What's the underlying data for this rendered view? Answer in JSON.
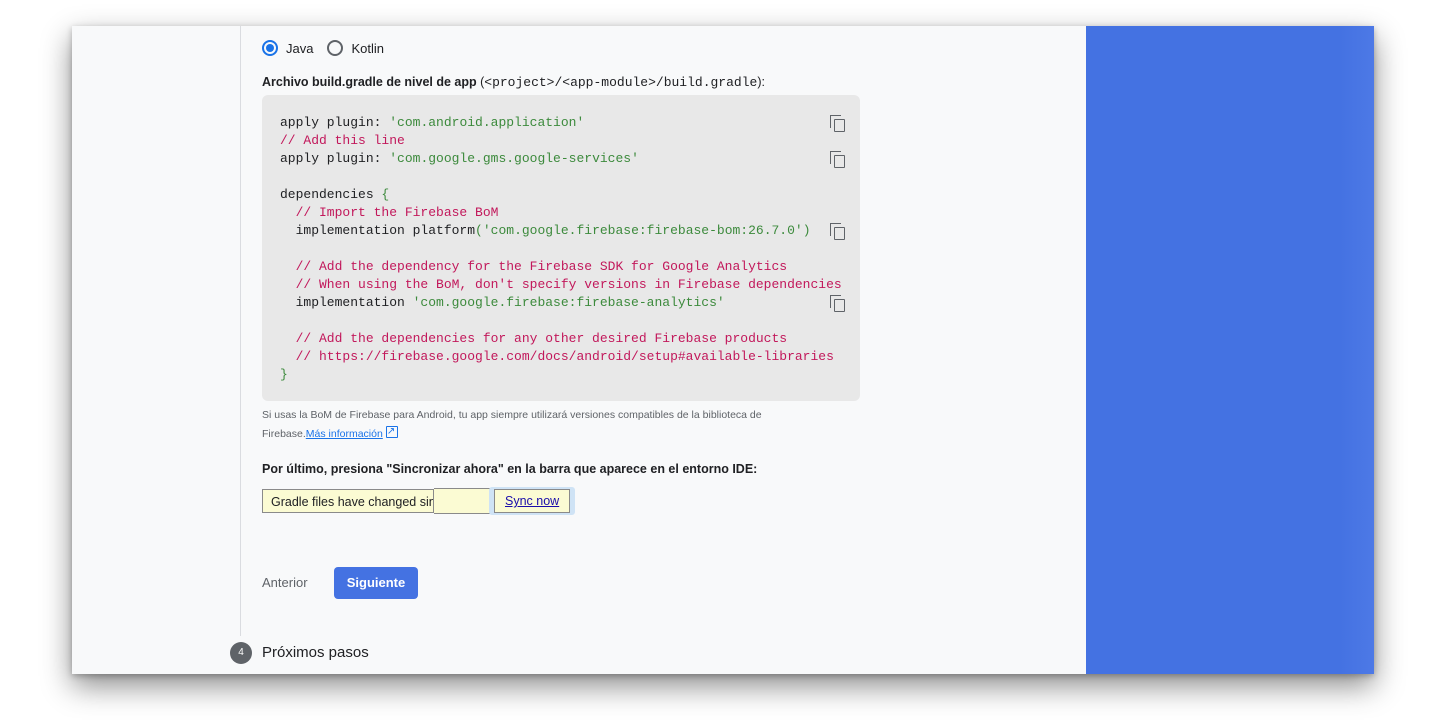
{
  "language_options": [
    {
      "label": "Java",
      "selected": true
    },
    {
      "label": "Kotlin",
      "selected": false
    }
  ],
  "file_label": {
    "bold": "Archivo build.gradle de nivel de app",
    "open": " (",
    "path": "<project>/<app-module>/build.gradle",
    "close": "):"
  },
  "code": {
    "l1a": "apply plugin",
    "l1b": ": ",
    "l1c": "'com.android.application'",
    "l2": "// Add this line",
    "l3a": "apply plugin",
    "l3b": ": ",
    "l3c": "'com.google.gms.google-services'",
    "l5a": "dependencies ",
    "l5b": "{",
    "l6": "  // Import the Firebase BoM",
    "l7a": "  implementation platform",
    "l7b": "(",
    "l7c": "'com.google.firebase:firebase-bom:26.7.0'",
    "l7d": ")",
    "l9": "  // Add the dependency for the Firebase SDK for Google Analytics",
    "l10": "  // When using the BoM, don't specify versions in Firebase dependencies",
    "l11a": "  implementation ",
    "l11b": "'com.google.firebase:firebase-analytics'",
    "l13": "  // Add the dependencies for any other desired Firebase products",
    "l14": "  // https://firebase.google.com/docs/android/setup#available-libraries",
    "l15": "}"
  },
  "note": {
    "text": "Si usas la BoM de Firebase para Android, tu app siempre utilizará versiones compatibles de la biblioteca de Firebase.",
    "link": "Más información"
  },
  "final_instruction": "Por último, presiona \"Sincronizar ahora\" en la barra que aparece en el entorno IDE:",
  "gradle_bar": {
    "message": "Gradle files have changed since",
    "sync_label": "Sync now"
  },
  "buttons": {
    "previous": "Anterior",
    "next": "Siguiente"
  },
  "next_step": {
    "number": "4",
    "title": "Próximos pasos"
  },
  "colors": {
    "accent": "#4472e2",
    "link": "#1a73e8",
    "comment": "#c2185b",
    "string": "#3c8a3c"
  }
}
